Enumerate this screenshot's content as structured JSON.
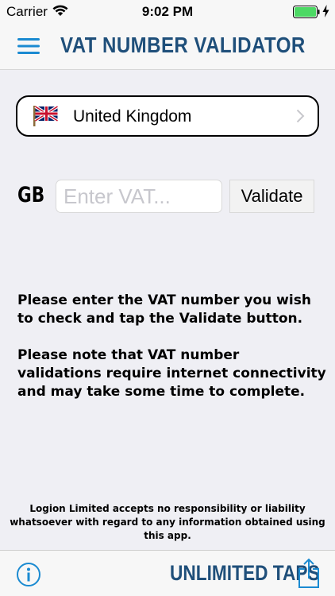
{
  "status_bar": {
    "carrier": "Carrier",
    "time": "9:02 PM",
    "battery_color": "#4cd964"
  },
  "nav": {
    "title": "VAT NUMBER VALIDATOR",
    "accent_color": "#1f4f7a",
    "menu_icon": "hamburger-menu-icon"
  },
  "country": {
    "name": "United Kingdom",
    "flag_icon": "uk-flag-icon",
    "chevron_icon": "chevron-right-icon"
  },
  "vat_form": {
    "country_code": "GB",
    "input_value": "",
    "input_placeholder": "Enter VAT...",
    "validate_label": "Validate"
  },
  "instructions": {
    "paragraph_1": "Please enter the VAT number you wish to check and tap the Validate button.",
    "paragraph_2": "Please note that VAT number validations require internet connectivity and may take some time to complete."
  },
  "disclaimer": "Logion Limited accepts no responsibility or liability whatsoever with regard to any information obtained using this app.",
  "tab_bar": {
    "info_icon": "info-icon",
    "unlimited_taps_label": "UNLIMITED TAPS",
    "share_icon": "share-icon"
  }
}
